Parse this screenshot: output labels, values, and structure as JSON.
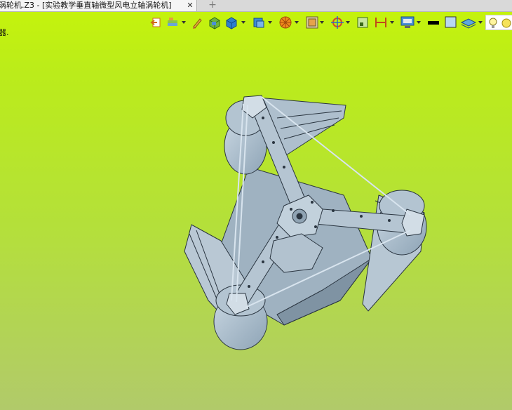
{
  "window": {
    "tab_title": "涡轮机.Z3 - [实验教学垂直轴微型风电立轴涡轮机]",
    "tab_close": "✕",
    "tab_add": "+",
    "side_label": "器."
  },
  "toolbar": {
    "icons": [
      "exit-icon",
      "layers-icon",
      "pencil-icon",
      "solid-box-icon",
      "view-cube-icon",
      "display-cube-icon",
      "render-wheel-icon",
      "frame-icon",
      "target-icon",
      "sketch-icon",
      "dimension-icon",
      "monitor-icon",
      "line-color-icon",
      "fill-color-icon",
      "plane-icon",
      "bulb-icon",
      "light-icon"
    ]
  },
  "viewport": {
    "background_top": "#c6f40a",
    "background_bottom": "#b1ca6a",
    "model_color": "#a9bccb",
    "edge_color": "#2a3540"
  }
}
